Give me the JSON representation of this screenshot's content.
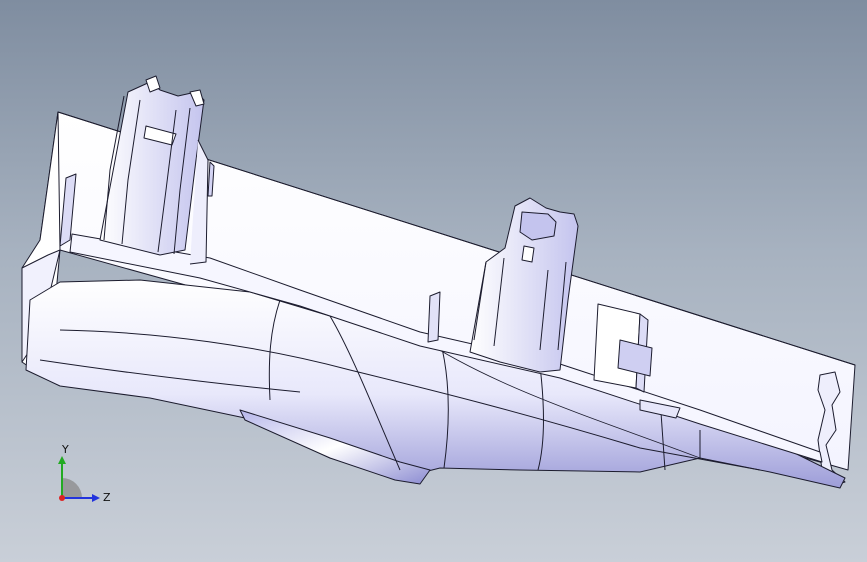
{
  "viewport": {
    "background_top": "#7f8da0",
    "background_bottom": "#c9cfd8",
    "part_fill": "#ffffff",
    "part_shade": "#c8c8f0",
    "edge_color": "#1c1c2e"
  },
  "triad": {
    "y_label": "Y",
    "z_label": "Z",
    "y_color": "#22aa22",
    "z_color": "#2233dd",
    "x_color": "#dd2222"
  }
}
